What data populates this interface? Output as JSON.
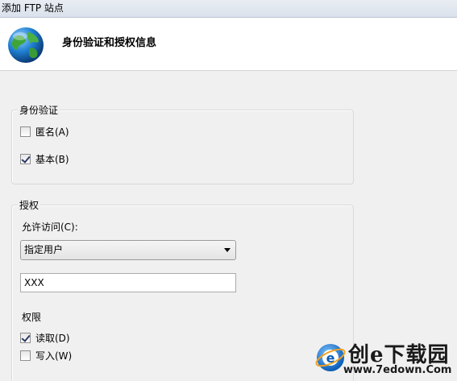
{
  "window": {
    "title": "添加 FTP 站点"
  },
  "header": {
    "title": "身份验证和授权信息"
  },
  "authentication": {
    "title": "身份验证",
    "anonymous": {
      "label": "匿名(A)",
      "checked": false
    },
    "basic": {
      "label": "基本(B)",
      "checked": true
    }
  },
  "authorization": {
    "title": "授权",
    "allow_access_label": "允许访问(C):",
    "allow_access_selected": "指定用户",
    "user_value": "XXX",
    "permissions_title": "权限",
    "read": {
      "label": "读取(D)",
      "checked": true
    },
    "write": {
      "label": "写入(W)",
      "checked": false
    }
  },
  "watermark": {
    "brand": "创e下载园",
    "url": "www.7edown.Com"
  }
}
